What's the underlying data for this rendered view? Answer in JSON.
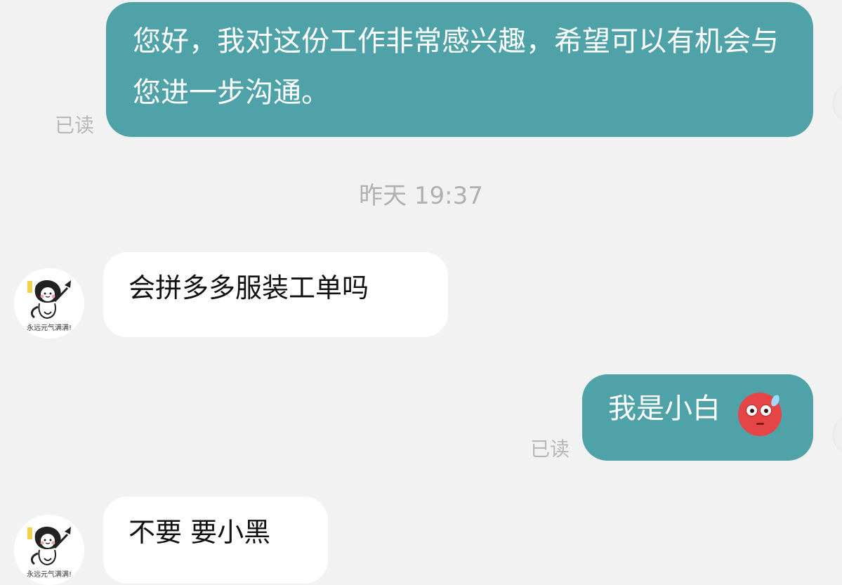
{
  "conversation": {
    "messages": [
      {
        "direction": "outgoing",
        "text": "您好，我对这份工作非常感兴趣，希望可以有机会与您进一步沟通。",
        "status": "已读"
      },
      {
        "direction": "incoming",
        "text": "会拼多多服装工单吗"
      },
      {
        "direction": "outgoing",
        "text": "我是小白",
        "emoji": "red-worried-face-icon",
        "status": "已读"
      },
      {
        "direction": "incoming",
        "text": "不要 要小黑"
      }
    ],
    "timestamp": "昨天 19:37",
    "avatar": {
      "caption": "永远元气满满!"
    }
  },
  "colors": {
    "background": "#f2f2f2",
    "outgoing_bubble": "#4fa3a8",
    "incoming_bubble": "#ffffff",
    "read_status": "#b7b7b7",
    "timestamp": "#b0b0b0"
  }
}
